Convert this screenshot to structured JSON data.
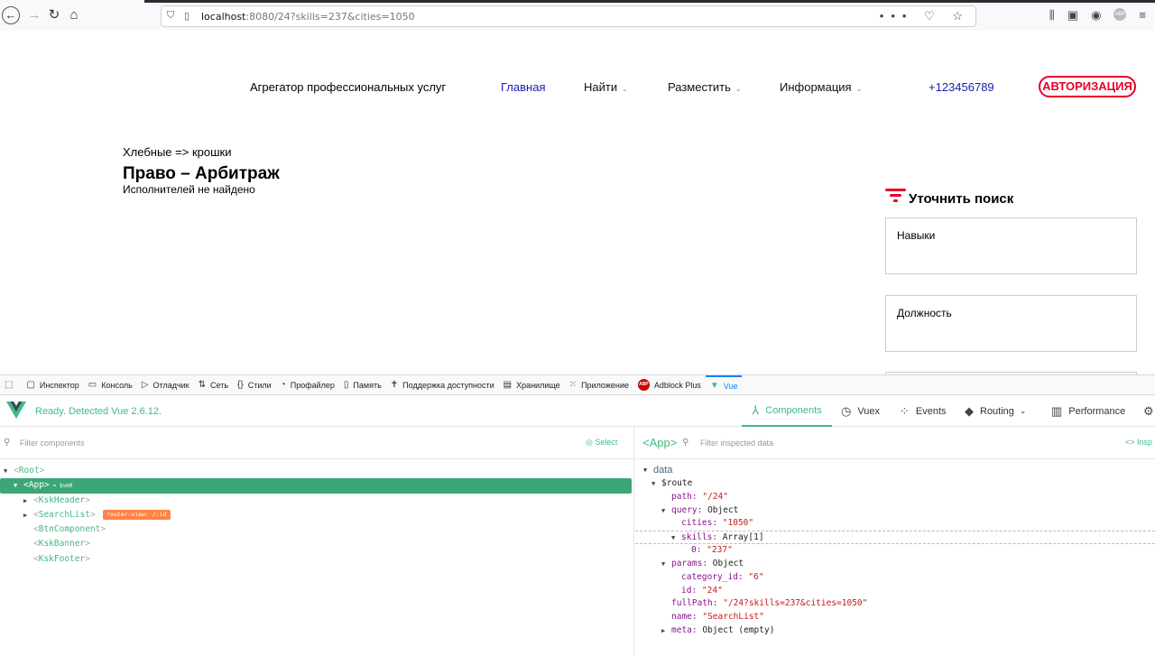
{
  "browser": {
    "url_host": "localhost",
    "url_rest": ":8080/24?skills=237&cities=1050"
  },
  "site": {
    "title": "Агрегатор профессиональных услуг",
    "nav": [
      {
        "label": "Главная",
        "active": true,
        "dropdown": false
      },
      {
        "label": "Найти",
        "active": false,
        "dropdown": true
      },
      {
        "label": "Разместить",
        "active": false,
        "dropdown": true
      },
      {
        "label": "Информация",
        "active": false,
        "dropdown": true
      }
    ],
    "phone": "+123456789",
    "auth_label": "АВТОРИЗАЦИЯ"
  },
  "main": {
    "breadcrumbs": "Хлебные => крошки",
    "page_title": "Право – Арбитраж",
    "empty_message": "Исполнителей не найдено"
  },
  "filter": {
    "title": "Уточнить поиск",
    "boxes": [
      "Навыки",
      "Должность"
    ]
  },
  "devtools": {
    "tabs": [
      {
        "label": "Инспектор",
        "icon": "inspector-icon"
      },
      {
        "label": "Консоль",
        "icon": "console-icon"
      },
      {
        "label": "Отладчик",
        "icon": "debugger-icon"
      },
      {
        "label": "Сеть",
        "icon": "network-icon"
      },
      {
        "label": "Стили",
        "icon": "style-editor-icon"
      },
      {
        "label": "Профайлер",
        "icon": "profiler-icon"
      },
      {
        "label": "Память",
        "icon": "memory-icon"
      },
      {
        "label": "Поддержка доступности",
        "icon": "accessibility-icon"
      },
      {
        "label": "Хранилище",
        "icon": "storage-icon"
      },
      {
        "label": "Приложение",
        "icon": "application-icon"
      },
      {
        "label": "Adblock Plus",
        "icon": "adblock-icon"
      },
      {
        "label": "Vue",
        "icon": "vue-icon"
      }
    ],
    "abp_badge": "ABP"
  },
  "vue": {
    "status": "Ready. Detected Vue 2.6.12.",
    "menu": {
      "components": "Components",
      "vuex": "Vuex",
      "events": "Events",
      "routing": "Routing",
      "performance": "Performance"
    },
    "filter_placeholder": "Filter components",
    "select_label": "Select",
    "tree": {
      "root": "Root",
      "app": "App",
      "vm": "= $vm0",
      "children": [
        "KskHeader",
        "SearchList",
        "BtnComponent",
        "KskBanner",
        "KskFooter"
      ],
      "router_badge": "router-view: /:id"
    },
    "inspector": {
      "component": "<App>",
      "filter_placeholder": "Filter inspected data",
      "inspect_link": "<> Insp",
      "section": "data",
      "route_key": "$route",
      "path_key": "path:",
      "path_val": "\"/24\"",
      "query_key": "query:",
      "query_type": "Object",
      "cities_key": "cities:",
      "cities_val": "\"1050\"",
      "skills_key": "skills:",
      "skills_type": "Array[1]",
      "skill0_key": "0:",
      "skill0_val": "\"237\"",
      "params_key": "params:",
      "params_type": "Object",
      "category_key": "category_id:",
      "category_val": "\"6\"",
      "id_key": "id:",
      "id_val": "\"24\"",
      "fullpath_key": "fullPath:",
      "fullpath_val": "\"/24?skills=237&cities=1050\"",
      "name_key": "name:",
      "name_val": "\"SearchList\"",
      "meta_key": "meta:",
      "meta_type": "Object (empty)"
    }
  }
}
